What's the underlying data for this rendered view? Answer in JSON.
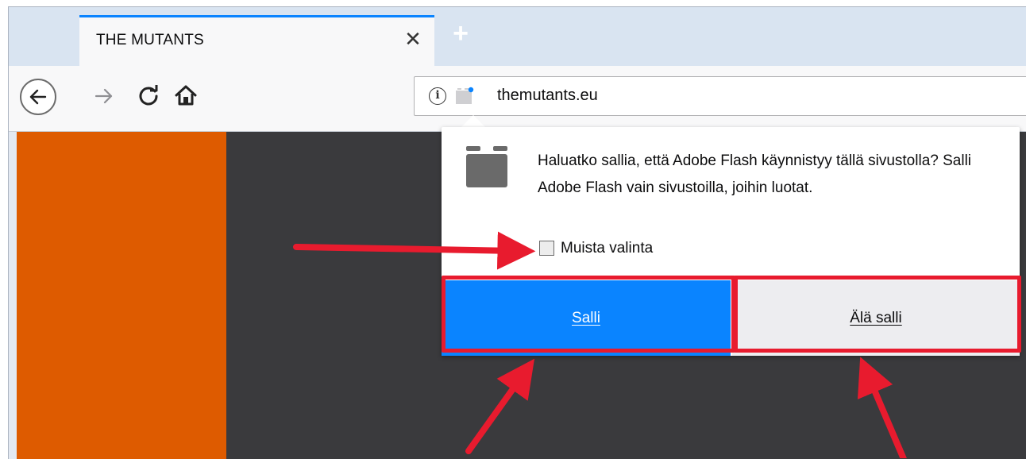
{
  "browser": {
    "tab": {
      "title": "THE MUTANTS",
      "close_glyph": "✕"
    },
    "new_tab_glyph": "+",
    "url": "themutants.eu",
    "icons": {
      "back": "back-arrow-icon",
      "forward": "forward-arrow-icon",
      "reload": "reload-icon",
      "home": "home-icon",
      "info": "info-icon",
      "plugin": "plugin-icon"
    },
    "info_glyph": "i"
  },
  "popup": {
    "message": "Haluatko sallia, että Adobe Flash käynnistyy tällä sivustolla? Salli Adobe Flash vain sivustoilla, joihin luotat.",
    "remember_label": "Muista valinta",
    "remember_checked": false,
    "allow_label": "Salli",
    "deny_label": "Älä salli"
  },
  "colors": {
    "accent": "#0a84ff",
    "annotation": "#e81b2e",
    "page_orange": "#de5b00",
    "page_dark": "#3a3a3d"
  }
}
